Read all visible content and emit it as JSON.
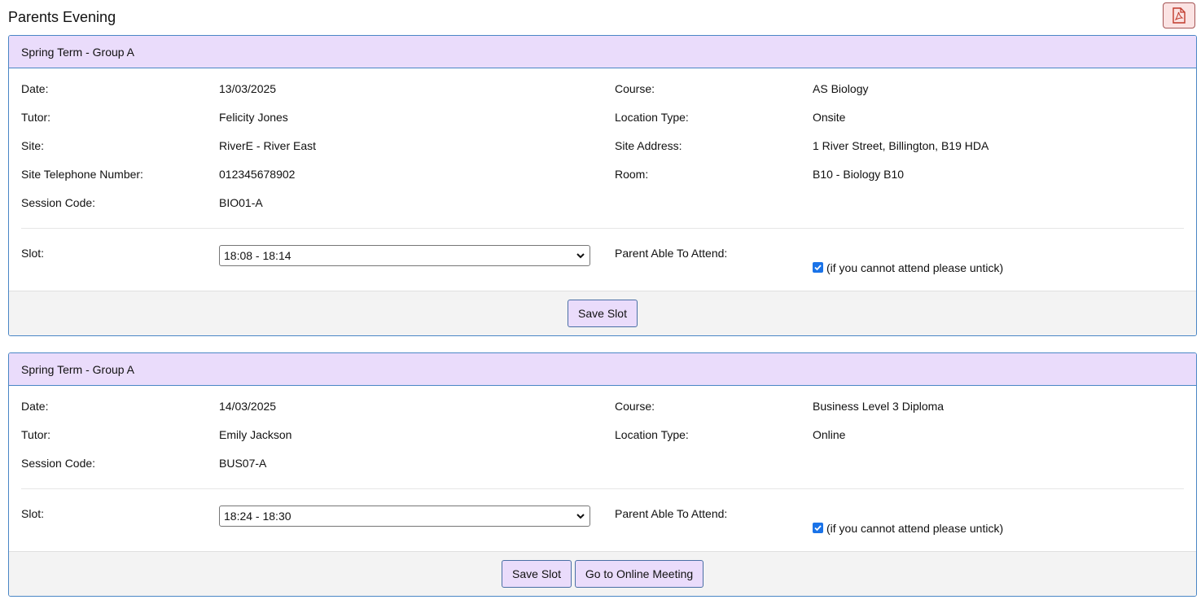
{
  "page": {
    "title": "Parents Evening",
    "pdf_icon": "pdf-icon"
  },
  "colors": {
    "header_bg": "#eadcfb",
    "border": "#4a86c5",
    "button_bg": "#eadcfb",
    "pdf_button_bg": "#fbe3e3",
    "checkbox": "#1a73e8"
  },
  "cards": [
    {
      "header": "Spring Term - Group A",
      "labels": {
        "date": "Date:",
        "course": "Course:",
        "tutor": "Tutor:",
        "location_type": "Location Type:",
        "site": "Site:",
        "site_address": "Site Address:",
        "site_phone": "Site Telephone Number:",
        "room": "Room:",
        "session_code": "Session Code:",
        "slot": "Slot:",
        "parent_attend": "Parent Able To Attend:"
      },
      "values": {
        "date": "13/03/2025",
        "course": "AS Biology",
        "tutor": "Felicity Jones",
        "location_type": "Onsite",
        "site": "RiverE - River East",
        "site_address": "1 River Street, Billington, B19 HDA",
        "site_phone": "012345678902",
        "room": "B10 - Biology B10",
        "session_code": "BIO01-A",
        "slot": "18:08 - 18:14",
        "attend_note": "(if you cannot attend please untick)"
      },
      "buttons": {
        "save": "Save Slot"
      }
    },
    {
      "header": "Spring Term - Group A",
      "labels": {
        "date": "Date:",
        "course": "Course:",
        "tutor": "Tutor:",
        "location_type": "Location Type:",
        "session_code": "Session Code:",
        "slot": "Slot:",
        "parent_attend": "Parent Able To Attend:"
      },
      "values": {
        "date": "14/03/2025",
        "course": "Business Level 3 Diploma",
        "tutor": "Emily Jackson",
        "location_type": "Online",
        "session_code": "BUS07-A",
        "slot": "18:24 - 18:30",
        "attend_note": "(if you cannot attend please untick)"
      },
      "buttons": {
        "save": "Save Slot",
        "online": "Go to Online Meeting"
      }
    }
  ]
}
